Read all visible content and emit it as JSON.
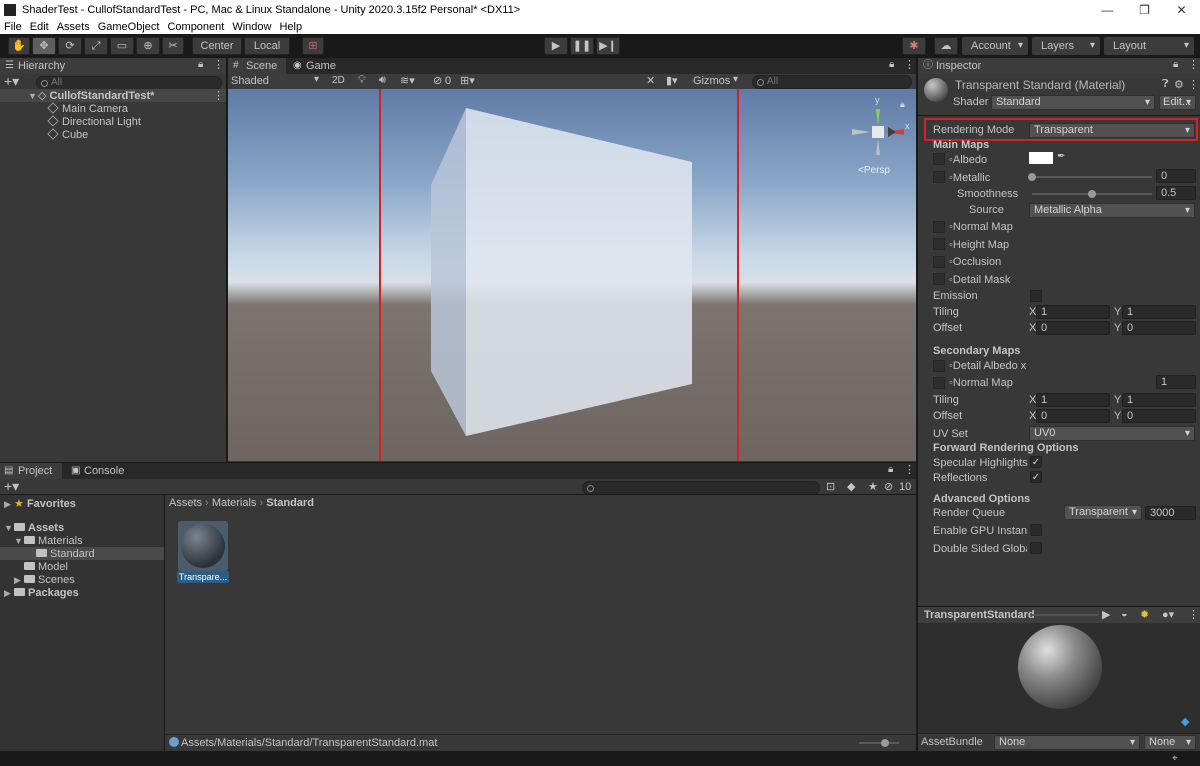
{
  "window": {
    "title": "ShaderTest - CullofStandardTest - PC, Mac & Linux Standalone - Unity 2020.3.15f2 Personal* <DX11>",
    "minimize": "—",
    "restore": "❐",
    "close": "✕"
  },
  "menu": [
    "File",
    "Edit",
    "Assets",
    "GameObject",
    "Component",
    "Window",
    "Help"
  ],
  "toolbar": {
    "pivot_label": "Center",
    "space_label": "Local",
    "account_label": "Account",
    "layers_label": "Layers",
    "layout_label": "Layout"
  },
  "hierarchy": {
    "tab": "Hierarchy",
    "search_placeholder": "All",
    "scene_name": "CullofStandardTest*",
    "items": [
      "Main Camera",
      "Directional Light",
      "Cube"
    ]
  },
  "scene": {
    "tabs": [
      "Scene",
      "Game"
    ],
    "shading": "Shaded",
    "mode_2d": "2D",
    "fx_count": "0",
    "gizmos": "Gizmos",
    "search_placeholder": "All",
    "persp": "Persp",
    "gizmo_axis_y": "y",
    "gizmo_axis_x": "x"
  },
  "project": {
    "tabs": [
      "Project",
      "Console"
    ],
    "favorites": "Favorites",
    "assets": "Assets",
    "materials": "Materials",
    "standard": "Standard",
    "model": "Model",
    "scenes": "Scenes",
    "packages": "Packages",
    "breadcrumb": [
      "Assets",
      "Materials",
      "Standard"
    ],
    "asset_label": "Transpare...",
    "hidden_count": "10",
    "footer_path": "Assets/Materials/Standard/TransparentStandard.mat"
  },
  "inspector": {
    "tab": "Inspector",
    "material_title": "Transparent Standard (Material)",
    "shader_label": "Shader",
    "shader_value": "Standard",
    "edit_button": "Edit...",
    "rendering_mode_label": "Rendering Mode",
    "rendering_mode_value": "Transparent",
    "main_maps": "Main Maps",
    "albedo": "Albedo",
    "metallic": "Metallic",
    "metallic_value": "0",
    "smoothness": "Smoothness",
    "smoothness_value": "0.5",
    "source": "Source",
    "source_value": "Metallic Alpha",
    "normal_map": "Normal Map",
    "height_map": "Height Map",
    "occlusion": "Occlusion",
    "detail_mask": "Detail Mask",
    "emission": "Emission",
    "tiling": "Tiling",
    "offset": "Offset",
    "x": "X",
    "y": "Y",
    "tiling_x": "1",
    "tiling_y": "1",
    "offset_x": "0",
    "offset_y": "0",
    "secondary_maps": "Secondary Maps",
    "detail_albedo": "Detail Albedo x",
    "sec_normal_map": "Normal Map",
    "sec_normal_value": "1",
    "sec_tiling_x": "1",
    "sec_tiling_y": "1",
    "sec_offset_x": "0",
    "sec_offset_y": "0",
    "uv_set": "UV Set",
    "uv_set_value": "UV0",
    "forward_rendering": "Forward Rendering Options",
    "specular_highlights": "Specular Highlights",
    "reflections": "Reflections",
    "advanced_options": "Advanced Options",
    "render_queue": "Render Queue",
    "render_queue_mode": "Transparent",
    "render_queue_value": "3000",
    "gpu_instancing": "Enable GPU Instanci",
    "double_sided": "Double Sided Global",
    "preview_title": "TransparentStandard",
    "asset_bundle": "AssetBundle",
    "asset_bundle_value": "None",
    "asset_bundle_variant": "None"
  },
  "colors": {
    "highlight": "#e0242e",
    "selection": "#2c5d87"
  },
  "slider_levels": {
    "smoothness": 0.5,
    "metallic": 0.0
  }
}
